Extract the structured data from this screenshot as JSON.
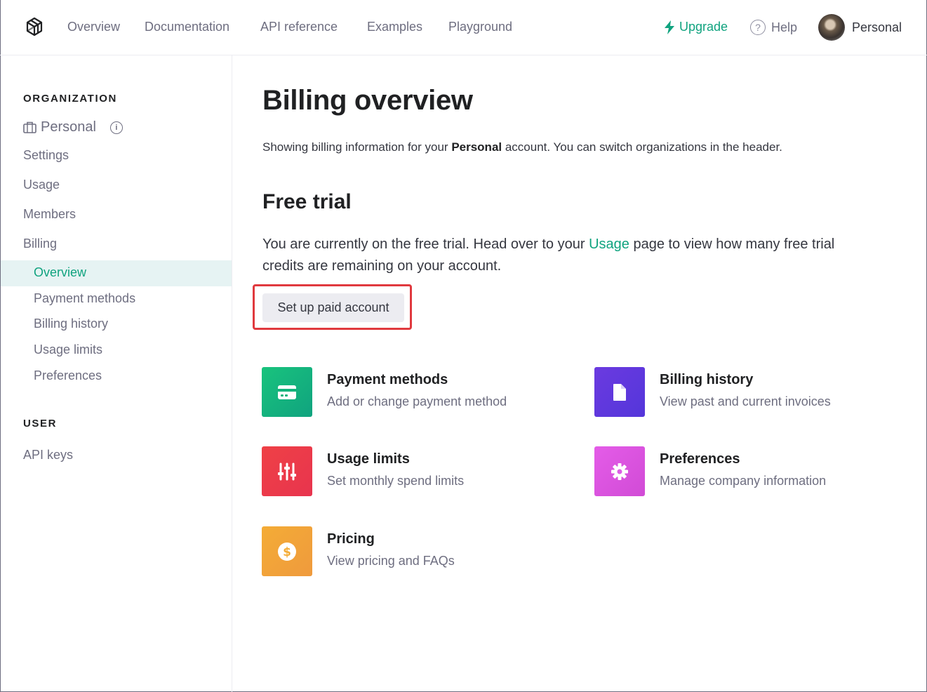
{
  "header": {
    "nav": [
      {
        "label": "Overview"
      },
      {
        "label": "Documentation"
      },
      {
        "label": "API reference"
      },
      {
        "label": "Examples"
      },
      {
        "label": "Playground"
      }
    ],
    "upgrade_label": "Upgrade",
    "help_label": "Help",
    "account_label": "Personal"
  },
  "sidebar": {
    "org_section": "ORGANIZATION",
    "org_name": "Personal",
    "items": [
      {
        "label": "Settings"
      },
      {
        "label": "Usage"
      },
      {
        "label": "Members"
      },
      {
        "label": "Billing"
      }
    ],
    "billing_sub": [
      {
        "label": "Overview",
        "active": true
      },
      {
        "label": "Payment methods"
      },
      {
        "label": "Billing history"
      },
      {
        "label": "Usage limits"
      },
      {
        "label": "Preferences"
      }
    ],
    "user_section": "USER",
    "user_items": [
      {
        "label": "API keys"
      }
    ]
  },
  "main": {
    "title": "Billing overview",
    "subtitle_pre": "Showing billing information for your ",
    "subtitle_bold": "Personal",
    "subtitle_post": " account. You can switch organizations in the header.",
    "trial_heading": "Free trial",
    "trial_text_pre": "You are currently on the free trial. Head over to your ",
    "trial_link": "Usage",
    "trial_text_post": " page to view how many free trial credits are remaining on your account.",
    "cta_label": "Set up paid account",
    "cards": [
      {
        "title": "Payment methods",
        "desc": "Add or change payment method",
        "icon": "credit-card-icon",
        "color": "#19c37d"
      },
      {
        "title": "Billing history",
        "desc": "View past and current invoices",
        "icon": "document-icon",
        "color": "#5436da"
      },
      {
        "title": "Usage limits",
        "desc": "Set monthly spend limits",
        "icon": "sliders-icon",
        "color": "#ef4146"
      },
      {
        "title": "Preferences",
        "desc": "Manage company information",
        "icon": "gear-icon",
        "color": "#dd5ce5"
      },
      {
        "title": "Pricing",
        "desc": "View pricing and FAQs",
        "icon": "dollar-icon",
        "color": "#f4ac36"
      }
    ]
  },
  "colors": {
    "accent": "#10a37f",
    "highlight": "#e0393e"
  }
}
